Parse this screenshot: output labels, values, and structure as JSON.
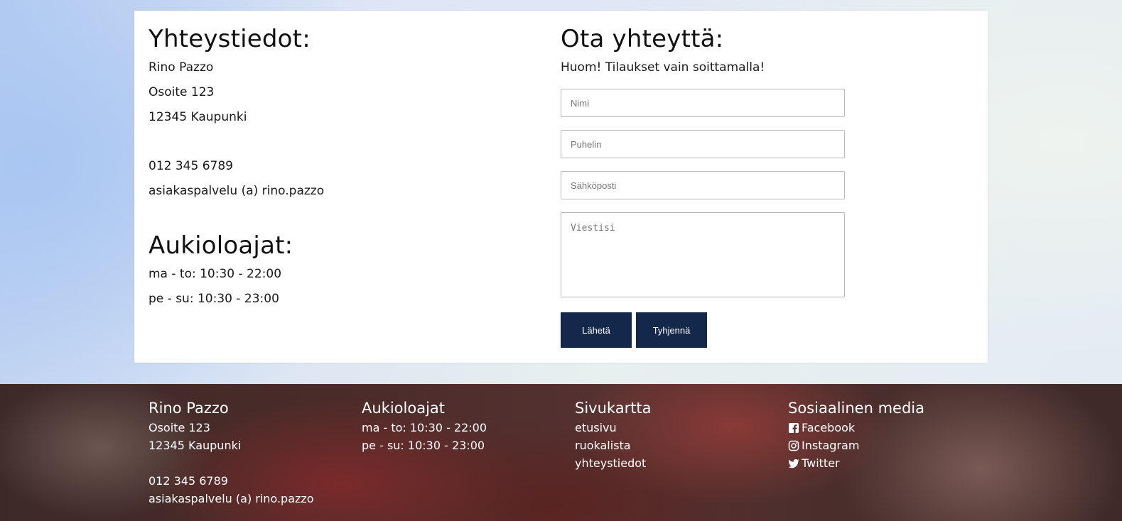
{
  "contact": {
    "heading": "Yhteystiedot:",
    "name": "Rino Pazzo",
    "address": "Osoite 123",
    "city": "12345 Kaupunki",
    "phone": "012 345 6789",
    "email": "asiakaspalvelu (a) rino.pazzo"
  },
  "hours": {
    "heading": "Aukioloajat:",
    "weekdays": "ma - to: 10:30 - 22:00",
    "weekend": "pe - su: 10:30 - 23:00"
  },
  "form": {
    "heading": "Ota yhteyttä:",
    "notice": "Huom! Tilaukset vain soittamalla!",
    "name_placeholder": "Nimi",
    "phone_placeholder": "Puhelin",
    "email_placeholder": "Sähköposti",
    "message_placeholder": "Viestisi",
    "submit_label": "Lähetä",
    "reset_label": "Tyhjennä",
    "button_color": "#13284a"
  },
  "footer": {
    "company": {
      "heading": "Rino Pazzo",
      "address": "Osoite 123",
      "city": "12345 Kaupunki",
      "phone": "012 345 6789",
      "email": "asiakaspalvelu (a) rino.pazzo"
    },
    "hours": {
      "heading": "Aukioloajat",
      "weekdays": "ma - to: 10:30 - 22:00",
      "weekend": "pe - su: 10:30 - 23:00"
    },
    "sitemap": {
      "heading": "Sivukartta",
      "links": [
        "etusivu",
        "ruokalista",
        "yhteystiedot"
      ]
    },
    "social": {
      "heading": "Sosiaalinen media",
      "links": [
        {
          "label": "Facebook",
          "icon": "facebook-icon"
        },
        {
          "label": "Instagram",
          "icon": "instagram-icon"
        },
        {
          "label": "Twitter",
          "icon": "twitter-icon"
        }
      ]
    }
  }
}
